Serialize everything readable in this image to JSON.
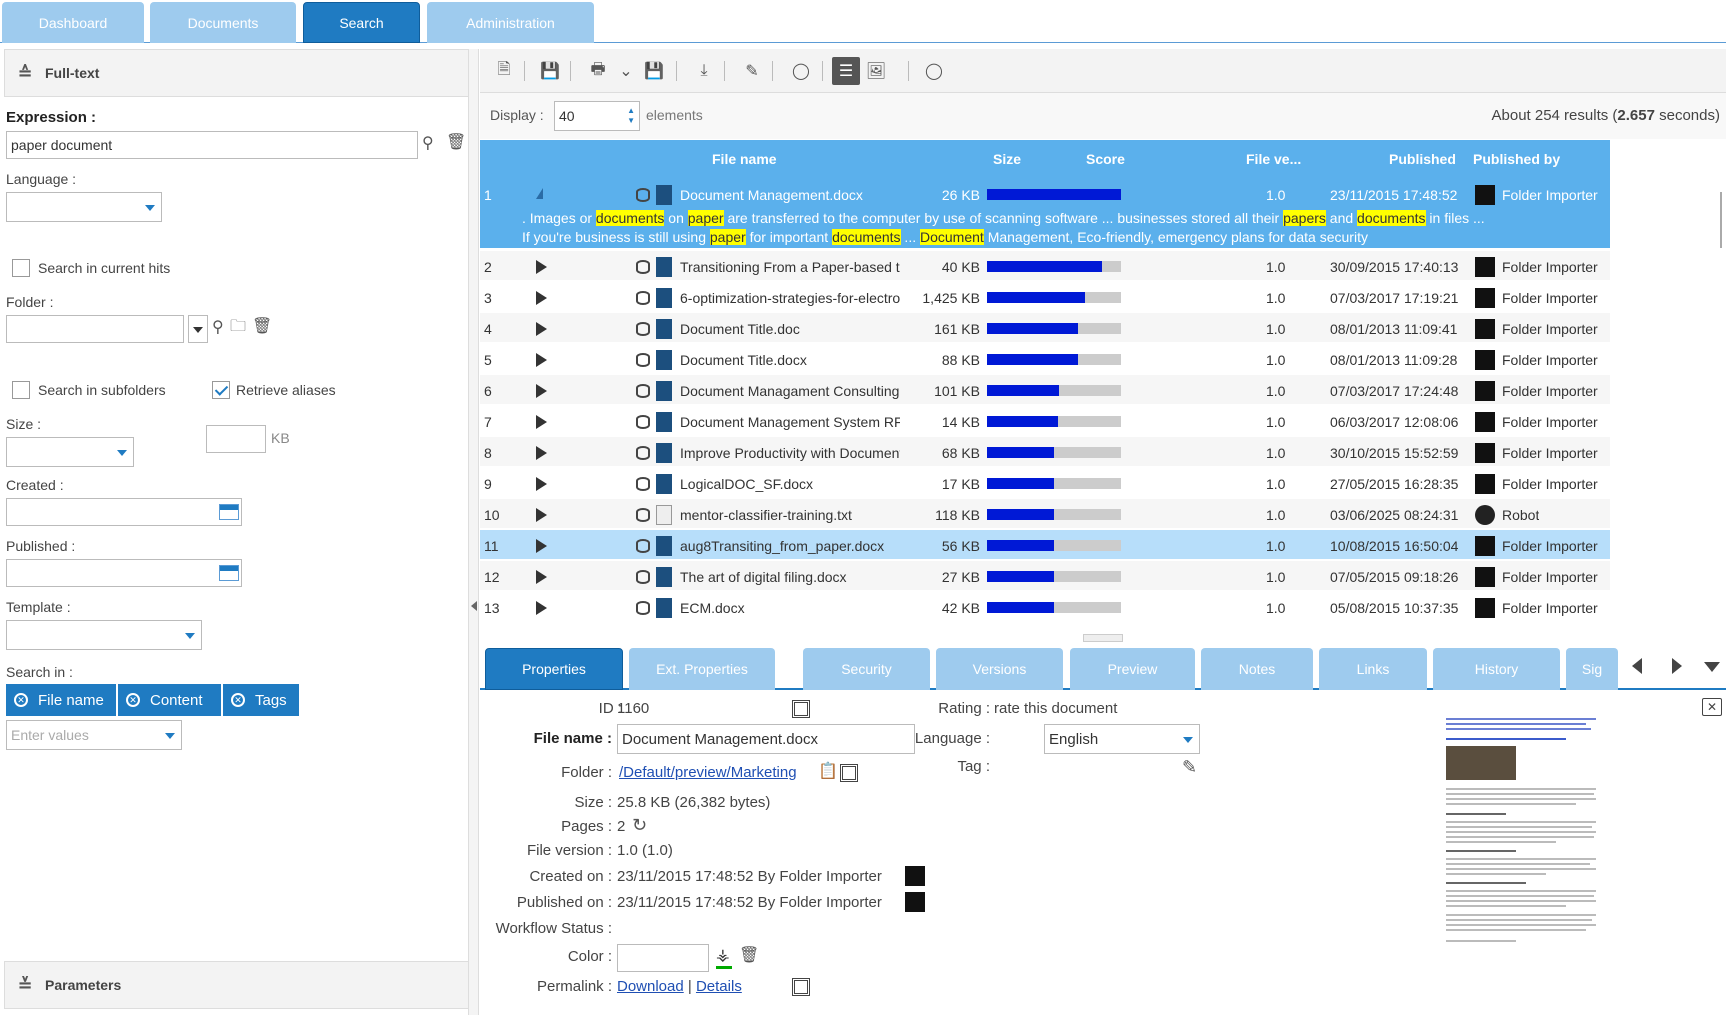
{
  "top_tabs": [
    "Dashboard",
    "Documents",
    "Search",
    "Administration"
  ],
  "left": {
    "fulltext_header": "Full-text",
    "expression_label": "Expression :",
    "expression_value": "paper document",
    "language_label": "Language :",
    "search_current_hits": "Search in current hits",
    "folder_label": "Folder :",
    "search_subfolders": "Search in subfolders",
    "retrieve_aliases": "Retrieve aliases",
    "size_label": "Size :",
    "size_unit": "KB",
    "created_label": "Created :",
    "published_label": "Published :",
    "template_label": "Template :",
    "search_in_label": "Search in :",
    "chips": [
      "File name",
      "Content",
      "Tags"
    ],
    "enter_values_placeholder": "Enter values",
    "parameters_header": "Parameters"
  },
  "display": {
    "label": "Display :",
    "value": "40",
    "suffix": "elements",
    "results_prefix": "About 254 results (",
    "results_seconds": "2.657",
    "results_suffix": " seconds)"
  },
  "grid": {
    "headers": [
      "File name",
      "Size",
      "Score",
      "File ve...",
      "Published",
      "Published by"
    ],
    "rows": [
      {
        "n": "1",
        "name": "Document Management.docx",
        "size": "26 KB",
        "score": 1.0,
        "ver": "1.0",
        "pub": "23/11/2015 17:48:52",
        "by": "Folder Importer"
      },
      {
        "n": "2",
        "name": "Transitioning From a Paper-based to",
        "size": "40 KB",
        "score": 0.86,
        "ver": "1.0",
        "pub": "30/09/2015 17:40:13",
        "by": "Folder Importer"
      },
      {
        "n": "3",
        "name": "6-optimization-strategies-for-electro",
        "size": "1,425 KB",
        "score": 0.73,
        "ver": "1.0",
        "pub": "07/03/2017 17:19:21",
        "by": "Folder Importer"
      },
      {
        "n": "4",
        "name": "Document Title.doc",
        "size": "161 KB",
        "score": 0.68,
        "ver": "1.0",
        "pub": "08/01/2013 11:09:41",
        "by": "Folder Importer"
      },
      {
        "n": "5",
        "name": "Document Title.docx",
        "size": "88 KB",
        "score": 0.68,
        "ver": "1.0",
        "pub": "08/01/2013 11:09:28",
        "by": "Folder Importer"
      },
      {
        "n": "6",
        "name": "Document Managament Consulting S",
        "size": "101 KB",
        "score": 0.54,
        "ver": "1.0",
        "pub": "07/03/2017 17:24:48",
        "by": "Folder Importer"
      },
      {
        "n": "7",
        "name": "Document Management System RFC",
        "size": "14 KB",
        "score": 0.53,
        "ver": "1.0",
        "pub": "06/03/2017 12:08:06",
        "by": "Folder Importer"
      },
      {
        "n": "8",
        "name": "Improve Productivity with Document",
        "size": "68 KB",
        "score": 0.5,
        "ver": "1.0",
        "pub": "30/10/2015 15:52:59",
        "by": "Folder Importer"
      },
      {
        "n": "9",
        "name": "LogicalDOC_SF.docx",
        "size": "17 KB",
        "score": 0.5,
        "ver": "1.0",
        "pub": "27/05/2015 16:28:35",
        "by": "Folder Importer"
      },
      {
        "n": "10",
        "name": "mentor-classifier-training.txt",
        "size": "118 KB",
        "score": 0.5,
        "ver": "1.0",
        "pub": "03/06/2025 08:24:31",
        "by": "Robot"
      },
      {
        "n": "11",
        "name": "aug8Transiting_from_paper.docx",
        "size": "56 KB",
        "score": 0.5,
        "ver": "1.0",
        "pub": "10/08/2015 16:50:04",
        "by": "Folder Importer"
      },
      {
        "n": "12",
        "name": "The art of digital filing.docx",
        "size": "27 KB",
        "score": 0.5,
        "ver": "1.0",
        "pub": "07/05/2015 09:18:26",
        "by": "Folder Importer"
      },
      {
        "n": "13",
        "name": "ECM.docx",
        "size": "42 KB",
        "score": 0.5,
        "ver": "1.0",
        "pub": "05/08/2015 10:37:35",
        "by": "Folder Importer"
      }
    ],
    "snippet_line1": [
      {
        "t": ". Images or ",
        "h": false
      },
      {
        "t": "documents",
        "h": true
      },
      {
        "t": " on ",
        "h": false
      },
      {
        "t": "paper",
        "h": true
      },
      {
        "t": " are transferred to the computer by use of scanning software ... businesses stored all their ",
        "h": false
      },
      {
        "t": "papers",
        "h": true
      },
      {
        "t": " and ",
        "h": false
      },
      {
        "t": "documents",
        "h": true
      },
      {
        "t": " in files ...",
        "h": false
      }
    ],
    "snippet_line2": [
      {
        "t": "If you're business is still using ",
        "h": false
      },
      {
        "t": "paper",
        "h": true
      },
      {
        "t": " for important ",
        "h": false
      },
      {
        "t": "documents",
        "h": true
      },
      {
        "t": " ... ",
        "h": false
      },
      {
        "t": "Document",
        "h": true
      },
      {
        "t": " Management, Eco-friendly, emergency plans for data security",
        "h": false
      }
    ]
  },
  "bottom_tabs": [
    "Properties",
    "Ext. Properties",
    "Security",
    "Versions",
    "Preview",
    "Notes",
    "Links",
    "History",
    "Sig"
  ],
  "props": {
    "id_label": "ID :",
    "id_value": "1160",
    "filename_label": "File name :",
    "filename_value": "Document Management.docx",
    "folder_label": "Folder :",
    "folder_value": "/Default/preview/Marketing",
    "size_label": "Size :",
    "size_value": "25.8 KB (26,382 bytes)",
    "pages_label": "Pages :",
    "pages_value": "2",
    "version_label": "File version :",
    "version_value": "1.0 (1.0)",
    "created_label": "Created on :",
    "created_value": "23/11/2015 17:48:52 By Folder Importer",
    "published_label": "Published on :",
    "published_value": "23/11/2015 17:48:52 By Folder Importer",
    "workflow_label": "Workflow Status :",
    "color_label": "Color :",
    "permalink_label": "Permalink :",
    "download": "Download",
    "separator": "|",
    "details": "Details",
    "rating_label": "Rating :",
    "rating_value": "rate this document",
    "language_label": "Language :",
    "language_value": "English",
    "tag_label": "Tag :"
  }
}
